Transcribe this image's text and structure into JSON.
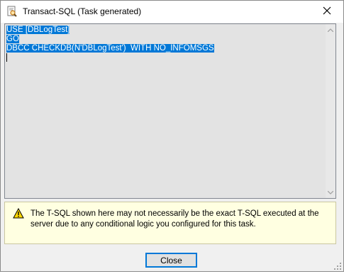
{
  "window": {
    "title": "Transact-SQL (Task generated)",
    "icon": "document-search-icon",
    "close_icon": "close-icon"
  },
  "editor": {
    "lines": [
      "USE [DBLogTest]",
      "GO",
      "DBCC CHECKDB(N'DBLogTest')  WITH NO_INFOMSGS"
    ],
    "selection_color": "#0078d7",
    "background_color": "#e3e3e3"
  },
  "notice": {
    "icon": "warning-icon",
    "text": "The T-SQL shown here may not necessarily be the exact T-SQL executed at the server due to any conditional logic you configured for this task.",
    "background_color": "#ffffe1"
  },
  "buttons": {
    "close_label": "Close"
  }
}
